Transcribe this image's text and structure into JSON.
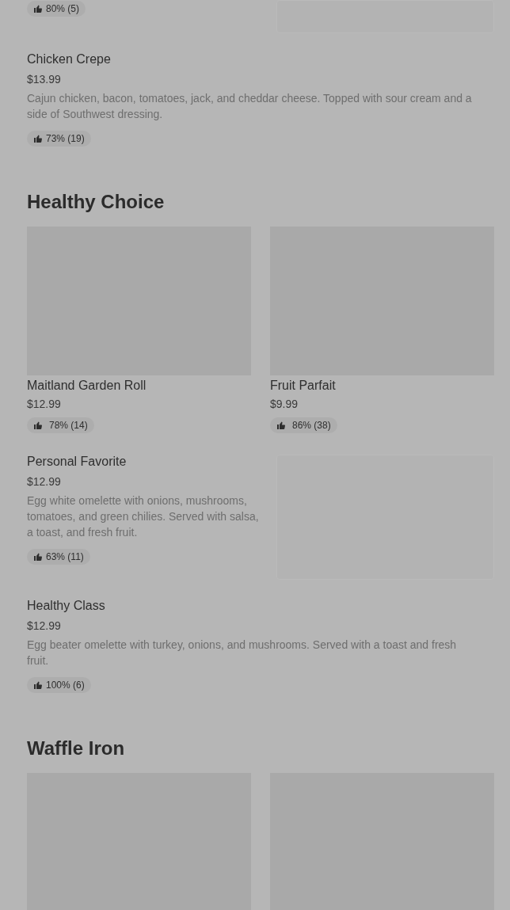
{
  "sections": [
    {
      "items": [
        {
          "kind": "list",
          "rating": "80% (5)",
          "image": true
        },
        {
          "kind": "list",
          "name": "Chicken Crepe",
          "price": "$13.99",
          "description": "Cajun chicken, bacon, tomatoes, jack, and cheddar cheese. Topped with sour cream and a side of Southwest dressing.",
          "rating": "73% (19)",
          "image": false
        }
      ]
    },
    {
      "title": "Healthy Choice",
      "items": [
        {
          "kind": "card",
          "name": "Maitland Garden Roll",
          "price": "$12.99",
          "rating": "78% (14)",
          "image": true
        },
        {
          "kind": "card",
          "name": "Fruit Parfait",
          "price": "$9.99",
          "rating": "86% (38)",
          "image": true
        },
        {
          "kind": "list",
          "name": "Personal Favorite",
          "price": "$12.99",
          "description": "Egg white omelette with onions, mushrooms, tomatoes, and green chilies. Served with salsa, a toast, and fresh fruit.",
          "rating": "63% (11)",
          "image": true
        },
        {
          "kind": "list",
          "name": "Healthy Class",
          "price": "$12.99",
          "description": "Egg beater omelette with turkey, onions, and mushrooms. Served with a toast and fresh fruit.",
          "rating": "100% (6)",
          "image": false
        }
      ]
    },
    {
      "title": "Waffle Iron",
      "items": [
        {
          "kind": "card",
          "image": true
        },
        {
          "kind": "card",
          "image": true
        }
      ]
    }
  ]
}
